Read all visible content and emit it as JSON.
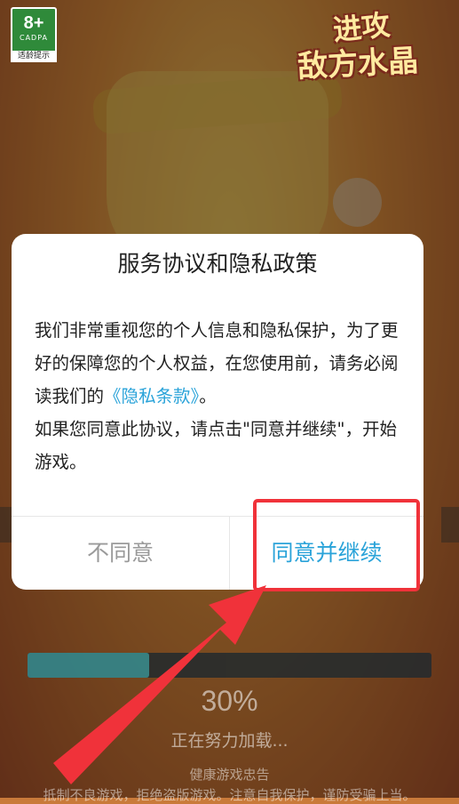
{
  "rating": {
    "age": "8+",
    "org": "CADPA",
    "tip": "适龄提示"
  },
  "logo": {
    "line1": "进攻",
    "line2": "敌方水晶"
  },
  "dialog": {
    "title": "服务协议和隐私政策",
    "body_line1": "我们非常重视您的个人信息和隐私保护，为了更好的保障您的个人权益，在您使用前，请务必阅读我们的",
    "privacy_link": "《隐私条款》",
    "body_line1_end": "。",
    "body_line2": "如果您同意此协议，请点击\"同意并继续\"，开始游戏。",
    "decline_label": "不同意",
    "accept_label": "同意并继续"
  },
  "loading": {
    "progress": 0.3,
    "percent_text": "30%",
    "status_text": "正在努力加载..."
  },
  "health_notice": {
    "title": "健康游戏忠告",
    "line": "抵制不良游戏，拒绝盗版游戏。注意自我保护，谨防受骗上当。"
  },
  "colors": {
    "accent": "#2aa3d9",
    "highlight": "#f0323a",
    "progress": "#2e8a92"
  },
  "icons": [
    "rating-badge-icon",
    "arrow-annotation-icon"
  ]
}
